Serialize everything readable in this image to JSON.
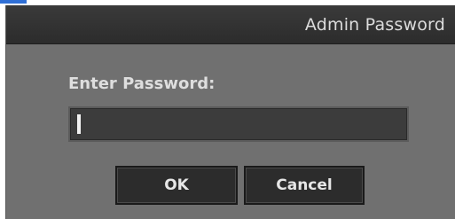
{
  "dialog": {
    "title": "Admin Password",
    "prompt_label": "Enter Password:",
    "password_value": "",
    "ok_label": "OK",
    "cancel_label": "Cancel"
  },
  "colors": {
    "titlebar": "#2f2f2f",
    "body": "#707070",
    "input": "#3c3c3c",
    "button": "#2c2c2c",
    "text": "#dedede",
    "accent_mark": "#2f6fd6"
  }
}
